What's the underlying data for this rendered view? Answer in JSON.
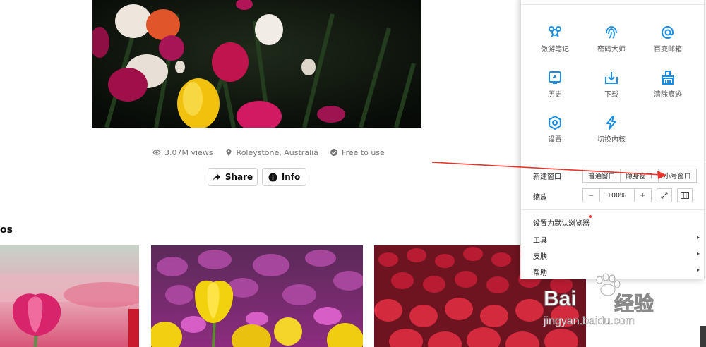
{
  "photo": {
    "views": "3.07M views",
    "location": "Roleystone, Australia",
    "license": "Free to use"
  },
  "actions": {
    "share_label": "Share",
    "info_label": "Info"
  },
  "section": {
    "title_fragment": "os"
  },
  "menu": {
    "apps": [
      {
        "label": "傲游笔记",
        "icon": "notes-icon"
      },
      {
        "label": "密码大师",
        "icon": "fingerprint-icon"
      },
      {
        "label": "百变邮箱",
        "icon": "mail-at-icon"
      },
      {
        "label": "历史",
        "icon": "history-icon"
      },
      {
        "label": "下载",
        "icon": "download-icon"
      },
      {
        "label": "清除痕迹",
        "icon": "clear-traces-icon"
      },
      {
        "label": "设置",
        "icon": "gear-icon"
      },
      {
        "label": "切换内核",
        "icon": "lightning-icon"
      }
    ],
    "new_window": {
      "label": "新建窗口",
      "options": [
        "普通窗口",
        "隐身窗口",
        "小号窗口"
      ]
    },
    "zoom": {
      "label": "缩放",
      "minus": "−",
      "value": "100%",
      "plus": "+"
    },
    "set_default": "设置为默认浏览器",
    "items": [
      {
        "label": "工具"
      },
      {
        "label": "皮肤"
      },
      {
        "label": "帮助"
      }
    ],
    "caret": "▸"
  },
  "watermark": {
    "brand_a": "Bai",
    "brand_b": "经验",
    "url": "jingyan.baidu.com"
  },
  "colors": {
    "accent": "#1a8ee6",
    "arrow": "#e8342c"
  }
}
